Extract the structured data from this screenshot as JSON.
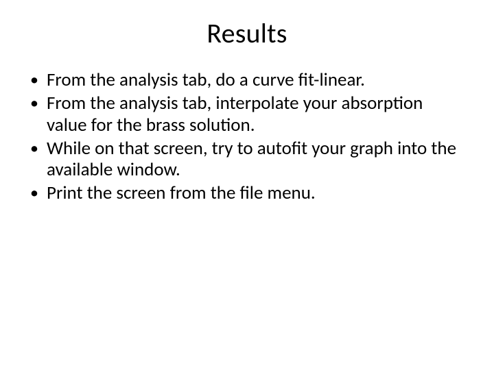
{
  "title": "Results",
  "bullets": [
    "From the analysis tab, do a curve fit-linear.",
    "From the analysis tab, interpolate your absorption value for the brass solution.",
    "While on that screen, try to autofit your graph into the available window.",
    "Print the screen from the file menu."
  ]
}
